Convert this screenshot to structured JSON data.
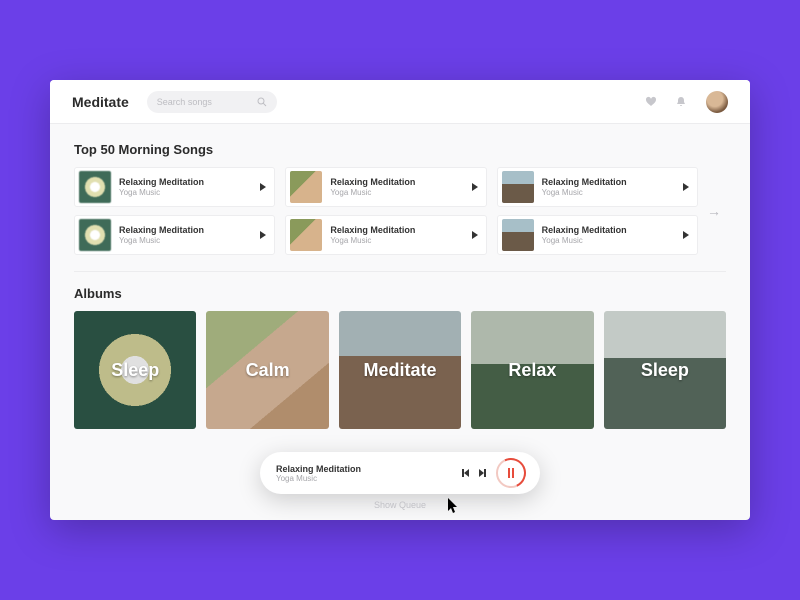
{
  "header": {
    "brand": "Meditate",
    "search_placeholder": "Search songs"
  },
  "sections": {
    "top_songs_title": "Top 50 Morning Songs",
    "albums_title": "Albums"
  },
  "songs": [
    {
      "title": "Relaxing Meditation",
      "artist": "Yoga Music",
      "thumb": "daisy"
    },
    {
      "title": "Relaxing Meditation",
      "artist": "Yoga Music",
      "thumb": "hands"
    },
    {
      "title": "Relaxing Meditation",
      "artist": "Yoga Music",
      "thumb": "rocks"
    },
    {
      "title": "Relaxing Meditation",
      "artist": "Yoga Music",
      "thumb": "daisy"
    },
    {
      "title": "Relaxing Meditation",
      "artist": "Yoga Music",
      "thumb": "hands"
    },
    {
      "title": "Relaxing Meditation",
      "artist": "Yoga Music",
      "thumb": "rocks"
    }
  ],
  "albums": [
    {
      "label": "Sleep",
      "cls": "al-sleep"
    },
    {
      "label": "Calm",
      "cls": "al-calm"
    },
    {
      "label": "Meditate",
      "cls": "al-med"
    },
    {
      "label": "Relax",
      "cls": "al-relax"
    },
    {
      "label": "Sleep",
      "cls": "al-sleep2"
    }
  ],
  "player": {
    "title": "Relaxing Meditation",
    "artist": "Yoga Music",
    "show_queue": "Show Queue"
  }
}
